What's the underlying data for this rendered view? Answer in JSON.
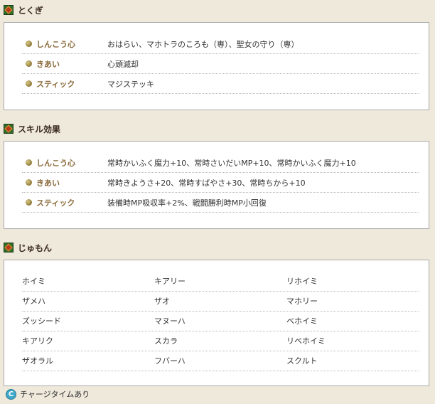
{
  "sections": [
    {
      "title": "とくぎ",
      "rows": [
        {
          "key": "しんこう心",
          "value": "おはらい、マホトラのころも（専）、聖女の守り（専）"
        },
        {
          "key": "きあい",
          "value": "心頭滅却"
        },
        {
          "key": "スティック",
          "value": "マジステッキ"
        }
      ]
    },
    {
      "title": "スキル効果",
      "rows": [
        {
          "key": "しんこう心",
          "value": "常時かいふく魔力+10、常時さいだいMP+10、常時かいふく魔力+10"
        },
        {
          "key": "きあい",
          "value": "常時きようさ+20、常時すばやさ+30、常時ちから+10"
        },
        {
          "key": "スティック",
          "value": "装備時MP吸収率+2%、戦闘勝利時MP小回復"
        }
      ]
    }
  ],
  "spells": {
    "title": "じゅもん",
    "rows": [
      [
        "ホイミ",
        "キアリー",
        "リホイミ"
      ],
      [
        "ザメハ",
        "ザオ",
        "マホリー"
      ],
      [
        "ズッシード",
        "マヌーハ",
        "ベホイミ"
      ],
      [
        "キアリク",
        "スカラ",
        "リベホイミ"
      ],
      [
        "ザオラル",
        "フバーハ",
        "スクルト"
      ]
    ]
  },
  "legend": {
    "icon_letter": "C",
    "label": "チャージタイムあり"
  },
  "colors": {
    "background": "#efe9dc",
    "key_text": "#8a6a3a",
    "charge_icon": "#3fa7c9"
  }
}
